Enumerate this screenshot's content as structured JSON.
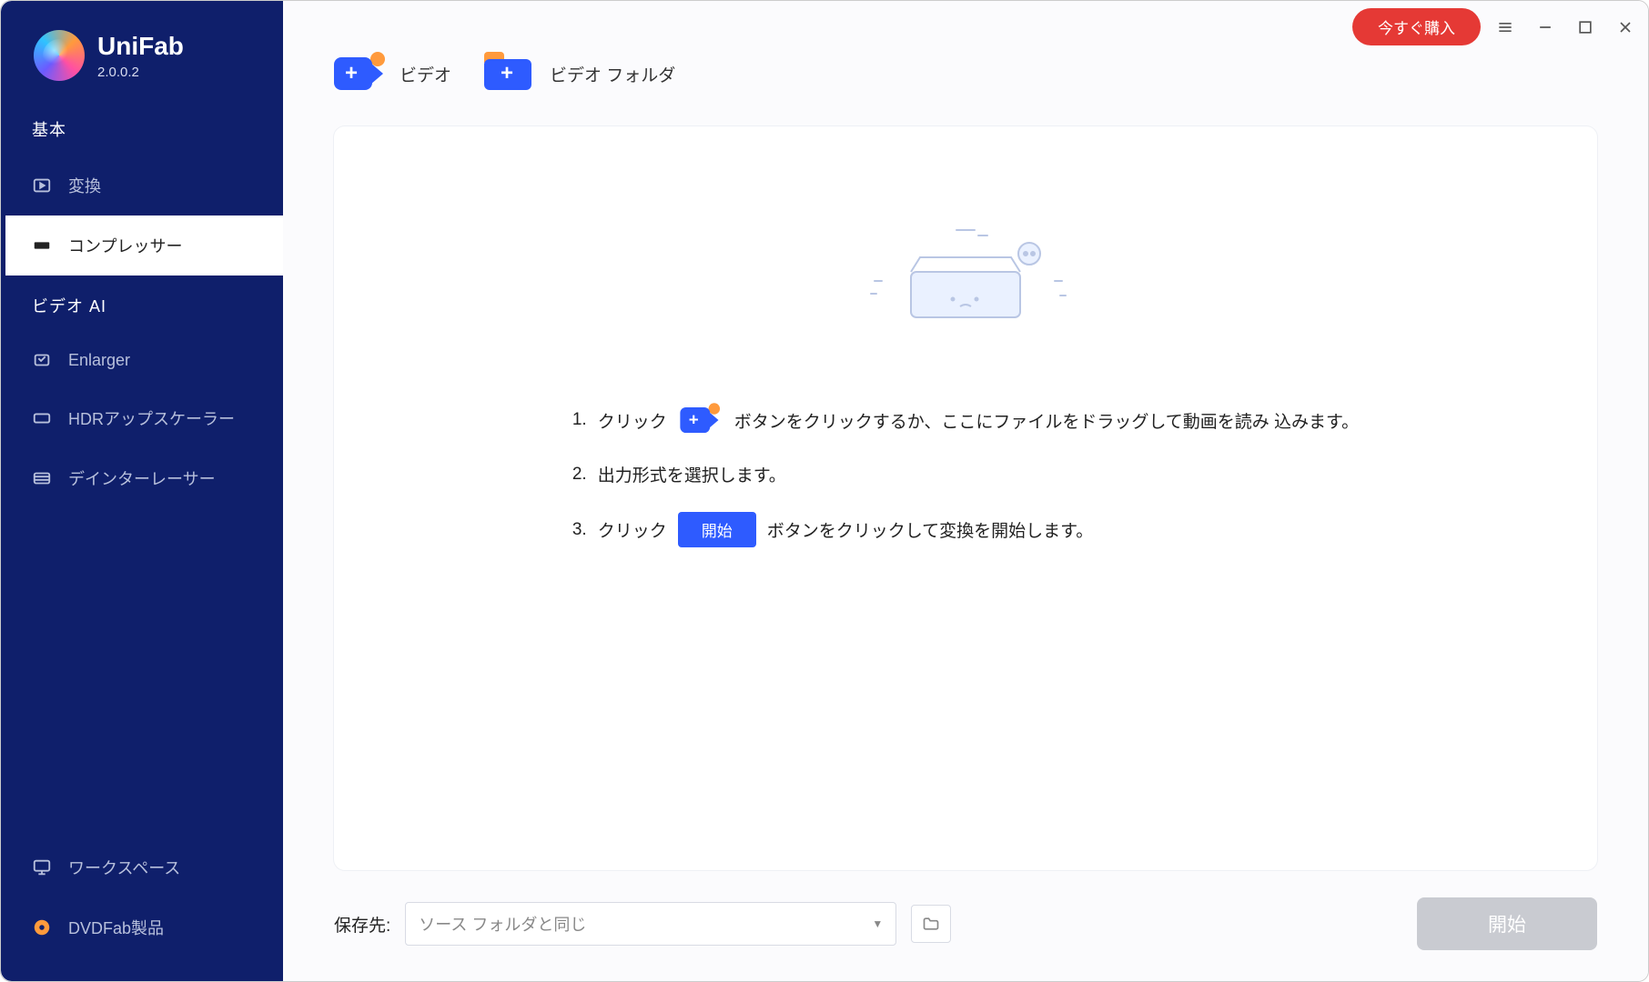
{
  "brand": {
    "name": "UniFab",
    "version": "2.0.0.2"
  },
  "titlebar": {
    "buy": "今すぐ購入"
  },
  "sidebar": {
    "section_basic": "基本",
    "section_ai": "ビデオ AI",
    "items": {
      "convert": "変換",
      "compressor": "コンプレッサー",
      "enlarger": "Enlarger",
      "hdr": "HDRアップスケーラー",
      "deinterlace": "デインターレーサー",
      "workspace": "ワークスペース",
      "dvdfab": "DVDFab製品"
    }
  },
  "toolbar": {
    "add_video": "ビデオ",
    "add_folder": "ビデオ フォルダ"
  },
  "instructions": {
    "n1": "1.",
    "n2": "2.",
    "n3": "3.",
    "click1": "クリック",
    "after1": "ボタンをクリックするか、ここにファイルをドラッグして動画を読み 込みます。",
    "step2": "出力形式を選択します。",
    "click3": "クリック",
    "start_small": "開始",
    "after3": "ボタンをクリックして変換を開始します。"
  },
  "footer": {
    "save_label": "保存先:",
    "dest_value": "ソース フォルダと同じ",
    "start": "開始"
  }
}
